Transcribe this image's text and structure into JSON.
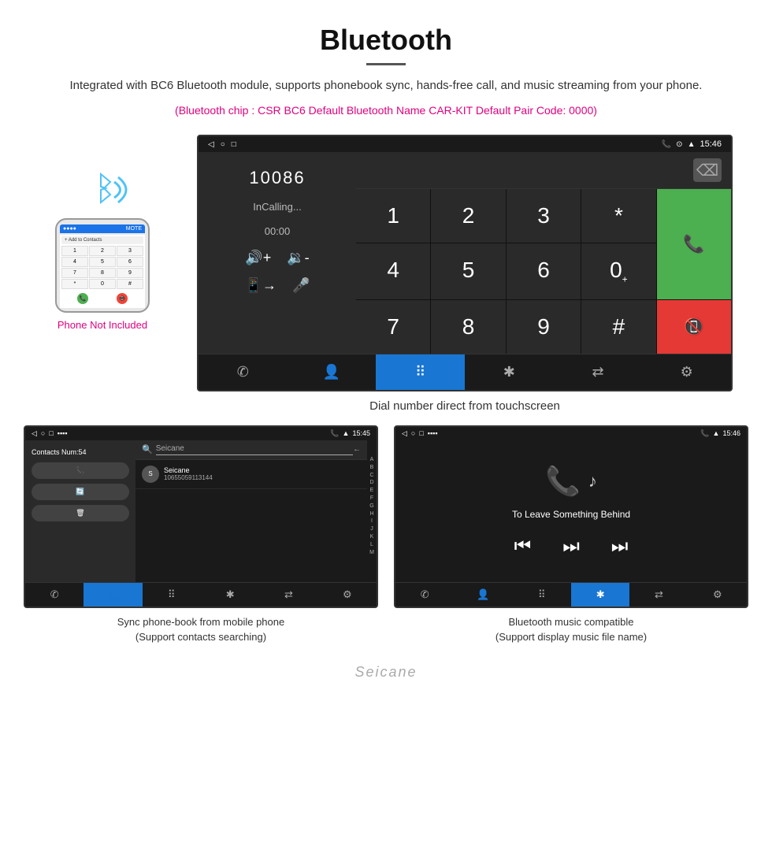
{
  "header": {
    "title": "Bluetooth",
    "description": "Integrated with BC6 Bluetooth module, supports phonebook sync, hands-free call, and music streaming from your phone.",
    "chip_info": "(Bluetooth chip : CSR BC6     Default Bluetooth Name CAR-KIT     Default Pair Code: 0000)"
  },
  "phone_section": {
    "not_included_label": "Phone Not Included"
  },
  "main_screen": {
    "status_bar": {
      "time": "15:46"
    },
    "dialed_number": "",
    "calling_status": "InCalling...",
    "call_timer": "00:00",
    "numpad": {
      "number_display": "10086",
      "keys": [
        "1",
        "2",
        "3",
        "*",
        "4",
        "5",
        "6",
        "0+",
        "7",
        "8",
        "9",
        "#"
      ]
    },
    "caption": "Dial number direct from touchscreen"
  },
  "contacts_screen": {
    "status_bar": {
      "time": "15:45"
    },
    "contacts_count": "Contacts Num:54",
    "search_placeholder": "Seicane",
    "contact_number": "10655059113144",
    "alpha_letters": [
      "A",
      "B",
      "C",
      "D",
      "E",
      "F",
      "G",
      "H",
      "I",
      "J",
      "K",
      "L",
      "M"
    ],
    "caption_line1": "Sync phone-book from mobile phone",
    "caption_line2": "(Support contacts searching)"
  },
  "music_screen": {
    "status_bar": {
      "time": "15:46"
    },
    "song_title": "To Leave Something Behind",
    "caption_line1": "Bluetooth music compatible",
    "caption_line2": "(Support display music file name)"
  },
  "watermark": "Seicane",
  "nav_icons": {
    "phone": "✆",
    "contacts": "👤",
    "dialpad": "⠿",
    "bluetooth": "✱",
    "transfer": "⇄",
    "settings": "⚙"
  }
}
